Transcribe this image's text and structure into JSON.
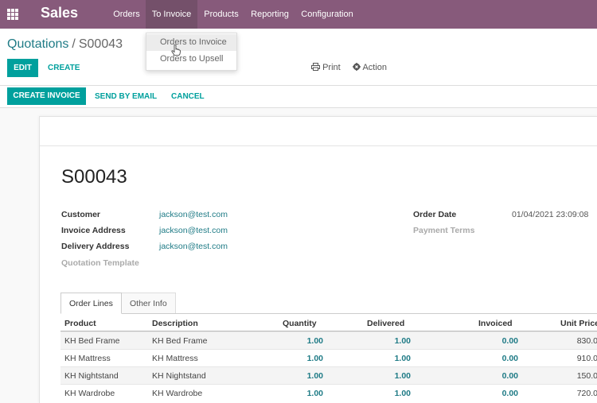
{
  "nav": {
    "app_name": "Sales",
    "menu": [
      "Orders",
      "To Invoice",
      "Products",
      "Reporting",
      "Configuration"
    ],
    "dropdown": [
      "Orders to Invoice",
      "Orders to Upsell"
    ]
  },
  "breadcrumb": {
    "parent": "Quotations",
    "separator": "/",
    "current": "S00043"
  },
  "buttons": {
    "edit": "EDIT",
    "create": "CREATE",
    "print": "Print",
    "action": "Action"
  },
  "status_buttons": {
    "create_invoice": "CREATE INVOICE",
    "send_email": "SEND BY EMAIL",
    "cancel": "CANCEL"
  },
  "record": {
    "name": "S00043",
    "customer_label": "Customer",
    "customer": "jackson@test.com",
    "invoice_address_label": "Invoice Address",
    "invoice_address": "jackson@test.com",
    "delivery_address_label": "Delivery Address",
    "delivery_address": "jackson@test.com",
    "quotation_template_label": "Quotation Template",
    "order_date_label": "Order Date",
    "order_date": "01/04/2021 23:09:08",
    "payment_terms_label": "Payment Terms"
  },
  "tabs": [
    "Order Lines",
    "Other Info"
  ],
  "table": {
    "columns": [
      "Product",
      "Description",
      "Quantity",
      "Delivered",
      "Invoiced",
      "Unit Price"
    ],
    "rows": [
      [
        "KH Bed Frame",
        "KH Bed Frame",
        "1.00",
        "1.00",
        "0.00",
        "830.0"
      ],
      [
        "KH Mattress",
        "KH Mattress",
        "1.00",
        "1.00",
        "0.00",
        "910.0"
      ],
      [
        "KH Nightstand",
        "KH Nightstand",
        "1.00",
        "1.00",
        "0.00",
        "150.0"
      ],
      [
        "KH Wardrobe",
        "KH Wardrobe",
        "1.00",
        "1.00",
        "0.00",
        "720.0"
      ]
    ]
  },
  "colors": {
    "navbar": "#875a7b",
    "primary": "#00a09d",
    "link": "#1f7b86"
  },
  "icons": [
    "apps-grid-icon",
    "print-icon",
    "gear-icon",
    "hand-cursor-icon"
  ]
}
